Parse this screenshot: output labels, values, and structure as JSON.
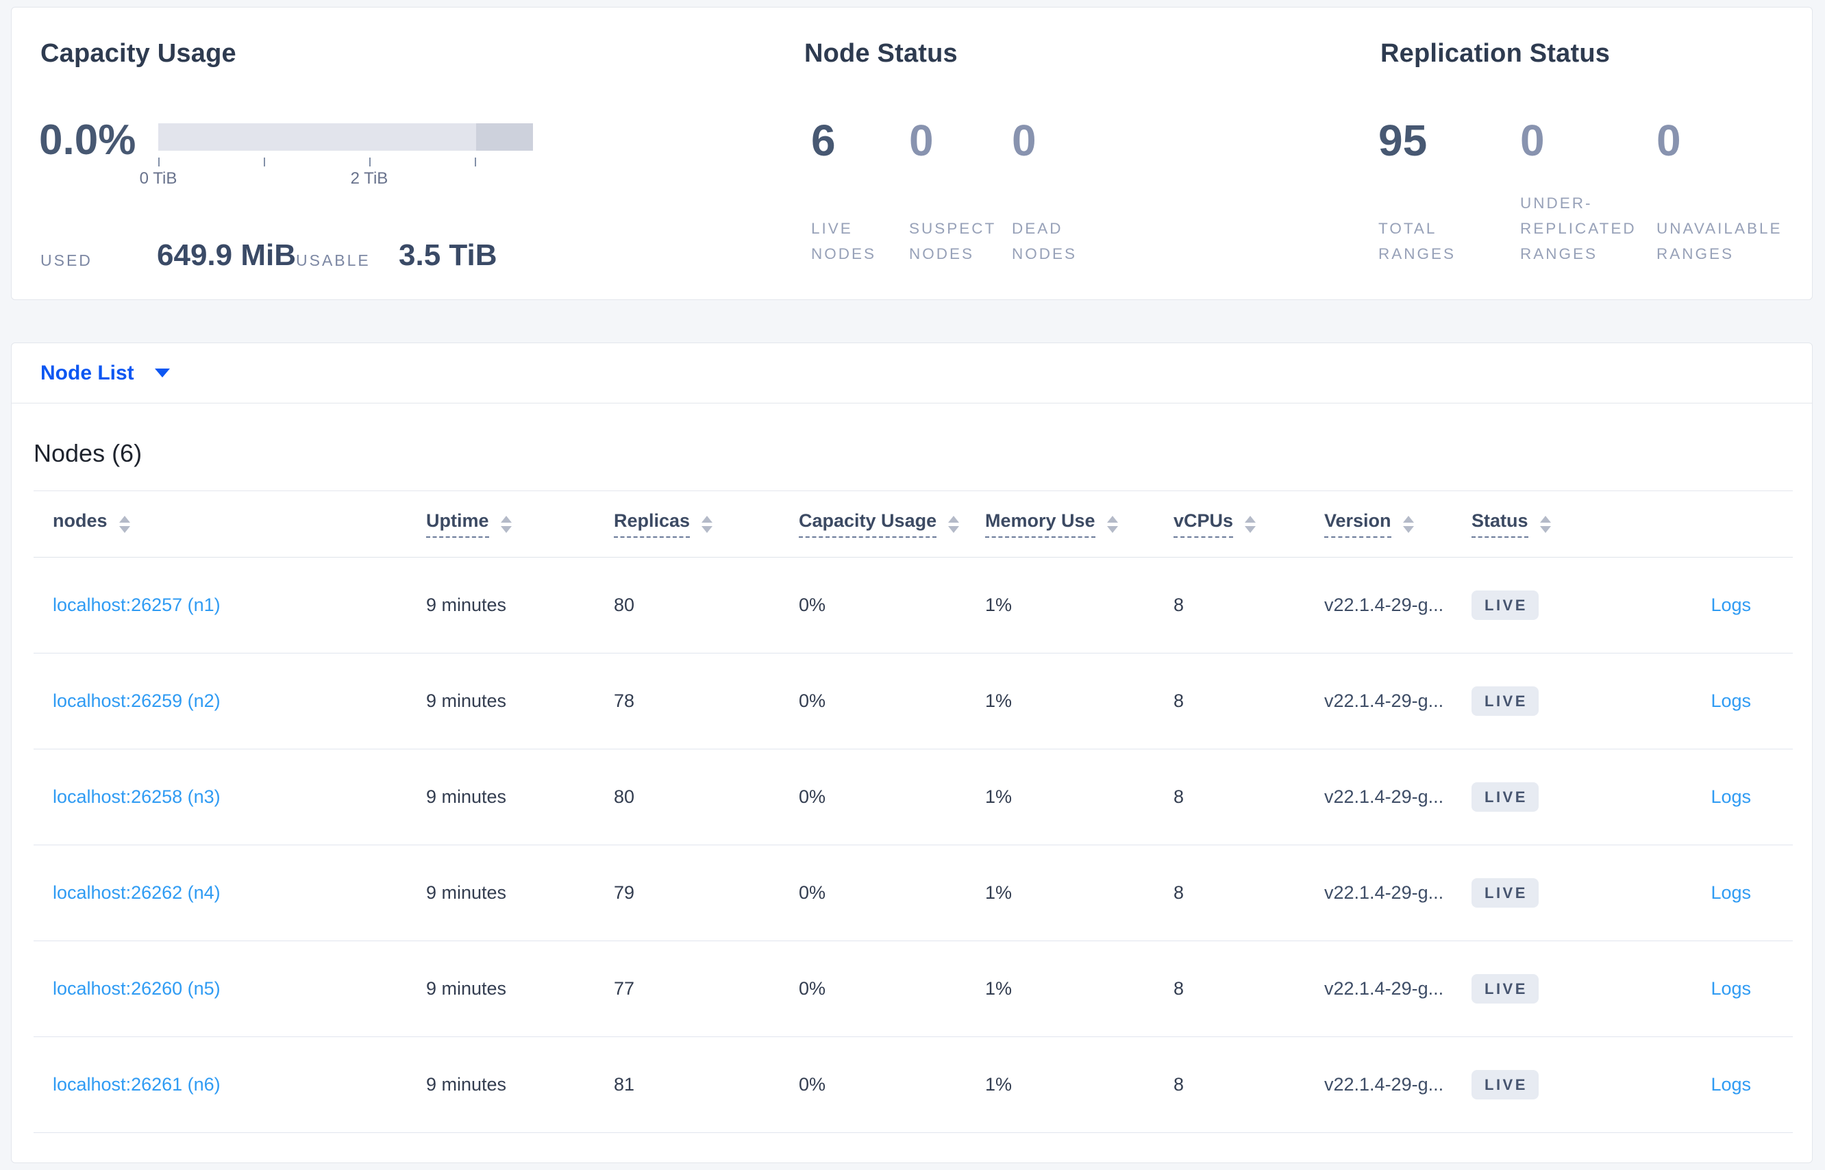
{
  "colors": {
    "page_bg": "#f4f6f9",
    "card_border": "#e3e6ec",
    "heading": "#2e3b50",
    "stat_number": "#475872",
    "stat_number_zero": "#8893af",
    "stat_label": "#97a1b8",
    "accent": "#0d57f2",
    "table_link": "#2f9bf3",
    "bar_usable": "#e2e4ec",
    "bar_other": "#cdd1dc",
    "badge_bg": "#e7ebf2",
    "badge_text": "#46546f"
  },
  "summary": {
    "capacity": {
      "title": "Capacity Usage",
      "percent_used": "0.0%",
      "bar": {
        "segments": [
          {
            "kind": "usable",
            "width_pct": 84.8
          },
          {
            "kind": "other",
            "width_pct": 15.2
          }
        ],
        "ticks": [
          {
            "pos_pct": 0,
            "label": "0 TiB"
          },
          {
            "pos_pct": 28.2,
            "label": ""
          },
          {
            "pos_pct": 56.3,
            "label": "2 TiB"
          },
          {
            "pos_pct": 84.5,
            "label": ""
          }
        ]
      },
      "used_label": "USED",
      "used_value": "649.9 MiB",
      "usable_label": "USABLE",
      "usable_value": "3.5 TiB"
    },
    "node_status": {
      "title": "Node Status",
      "stats": [
        {
          "value": "6",
          "label_lines": [
            "LIVE",
            "NODES"
          ],
          "emphasis": true
        },
        {
          "value": "0",
          "label_lines": [
            "SUSPECT",
            "NODES"
          ],
          "emphasis": false
        },
        {
          "value": "0",
          "label_lines": [
            "DEAD",
            "NODES"
          ],
          "emphasis": false
        }
      ]
    },
    "replication_status": {
      "title": "Replication Status",
      "stats": [
        {
          "value": "95",
          "label_lines": [
            "TOTAL",
            "RANGES"
          ],
          "emphasis": true
        },
        {
          "value": "0",
          "label_lines": [
            "UNDER-",
            "REPLICATED",
            "RANGES"
          ],
          "emphasis": false
        },
        {
          "value": "0",
          "label_lines": [
            "UNAVAILABLE",
            "RANGES"
          ],
          "emphasis": false
        }
      ]
    }
  },
  "selector": {
    "label": "Node List"
  },
  "table": {
    "title": "Nodes (6)",
    "columns": [
      {
        "label": "nodes",
        "underline": false
      },
      {
        "label": "Uptime",
        "underline": true
      },
      {
        "label": "Replicas",
        "underline": true
      },
      {
        "label": "Capacity Usage",
        "underline": true
      },
      {
        "label": "Memory Use",
        "underline": true
      },
      {
        "label": "vCPUs",
        "underline": true
      },
      {
        "label": "Version",
        "underline": true
      },
      {
        "label": "Status",
        "underline": true
      }
    ],
    "logs_label": "Logs",
    "rows": [
      {
        "node": "localhost:26257 (n1)",
        "uptime": "9 minutes",
        "replicas": "80",
        "capacity": "0%",
        "memory": "1%",
        "vcpus": "8",
        "version": "v22.1.4-29-g...",
        "status": "LIVE"
      },
      {
        "node": "localhost:26259 (n2)",
        "uptime": "9 minutes",
        "replicas": "78",
        "capacity": "0%",
        "memory": "1%",
        "vcpus": "8",
        "version": "v22.1.4-29-g...",
        "status": "LIVE"
      },
      {
        "node": "localhost:26258 (n3)",
        "uptime": "9 minutes",
        "replicas": "80",
        "capacity": "0%",
        "memory": "1%",
        "vcpus": "8",
        "version": "v22.1.4-29-g...",
        "status": "LIVE"
      },
      {
        "node": "localhost:26262 (n4)",
        "uptime": "9 minutes",
        "replicas": "79",
        "capacity": "0%",
        "memory": "1%",
        "vcpus": "8",
        "version": "v22.1.4-29-g...",
        "status": "LIVE"
      },
      {
        "node": "localhost:26260 (n5)",
        "uptime": "9 minutes",
        "replicas": "77",
        "capacity": "0%",
        "memory": "1%",
        "vcpus": "8",
        "version": "v22.1.4-29-g...",
        "status": "LIVE"
      },
      {
        "node": "localhost:26261 (n6)",
        "uptime": "9 minutes",
        "replicas": "81",
        "capacity": "0%",
        "memory": "1%",
        "vcpus": "8",
        "version": "v22.1.4-29-g...",
        "status": "LIVE"
      }
    ]
  }
}
